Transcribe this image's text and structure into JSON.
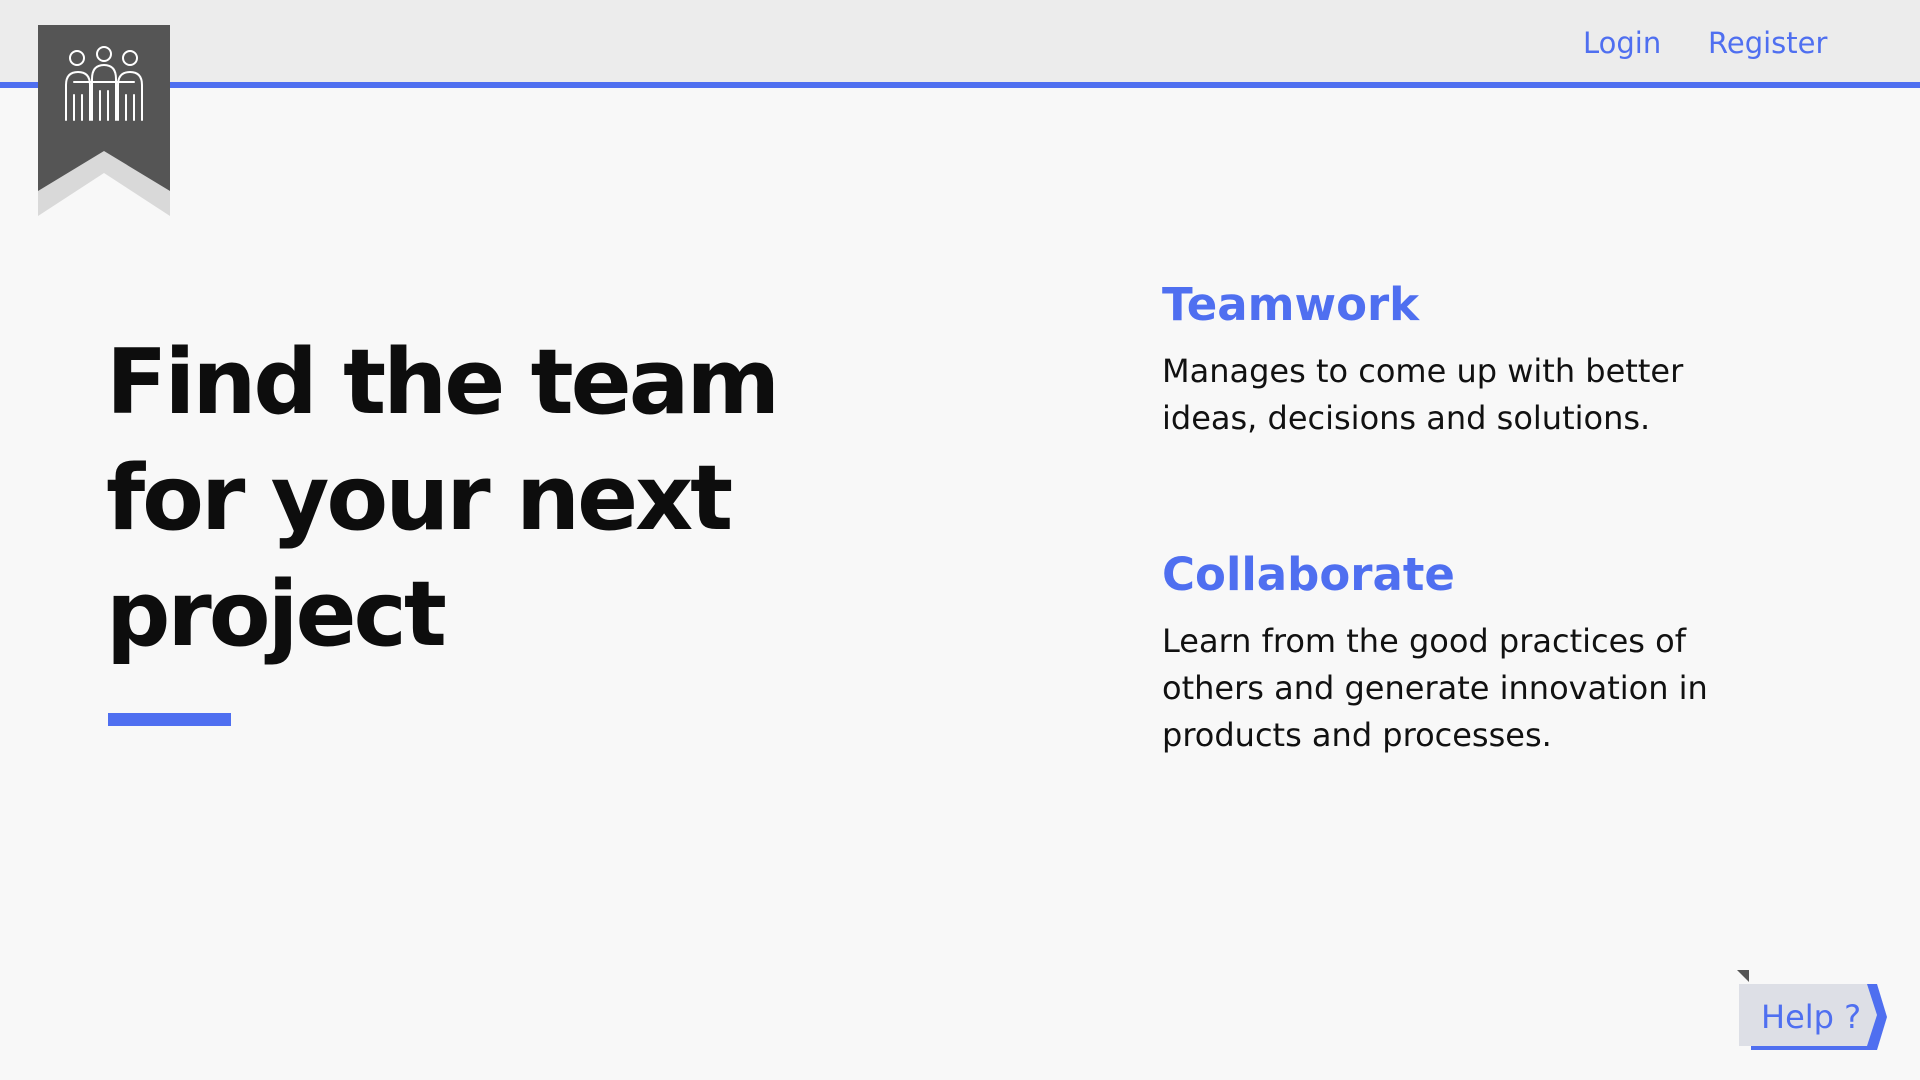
{
  "nav": {
    "login_label": "Login",
    "register_label": "Register"
  },
  "logo": {
    "icon": "team-people-icon"
  },
  "hero": {
    "line1": "Find the team",
    "line2": "for your next",
    "line3": "project"
  },
  "features": [
    {
      "title": "Teamwork",
      "line1": "Manages to come up with better",
      "line2": "ideas, decisions and solutions."
    },
    {
      "title": "Collaborate",
      "line1": "Learn from the good practices of",
      "line2": "others and generate innovation in",
      "line3": "products and processes."
    }
  ],
  "help": {
    "label": "Help ?"
  },
  "colors": {
    "accent": "#4f6ff0",
    "banner": "#555555",
    "topbar": "#ececec",
    "background": "#f8f8f8"
  }
}
